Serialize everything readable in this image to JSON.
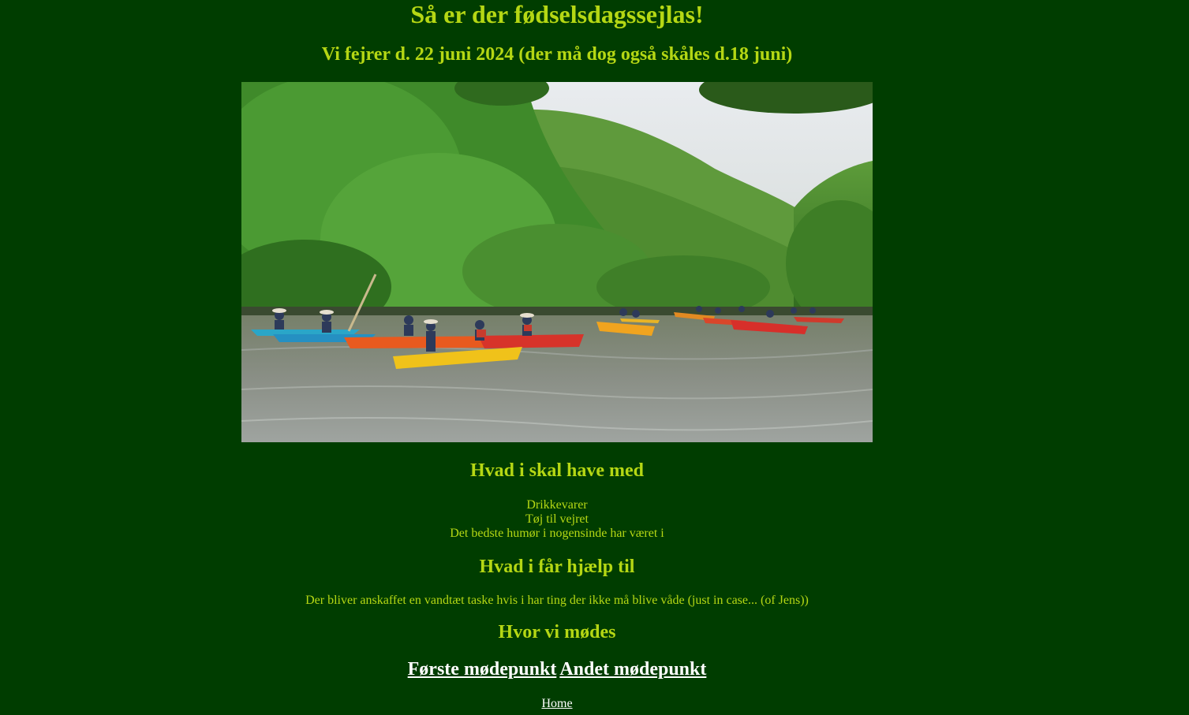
{
  "header": {
    "title": "Så er der fødselsdagssejlas!",
    "subtitle": "Vi fejrer d. 22 juni 2024 (der må dog også skåles d.18 juni)"
  },
  "bring": {
    "heading": "Hvad i skal have med",
    "items": [
      "Drikkevarer",
      "Tøj til vejret",
      "Det bedste humør i nogensinde har været i"
    ]
  },
  "help": {
    "heading": "Hvad i får hjælp til",
    "text": "Der bliver anskaffet en vandtæt taske hvis i har ting der ikke må blive våde (just in case... (of Jens))"
  },
  "meet": {
    "heading": "Hvor vi mødes",
    "link1": "Første mødepunkt",
    "link2": "Andet mødepunkt"
  },
  "footer": {
    "home": "Home"
  },
  "colors": {
    "background": "#003d00",
    "text": "#b5d714",
    "link": "#ffffff"
  }
}
